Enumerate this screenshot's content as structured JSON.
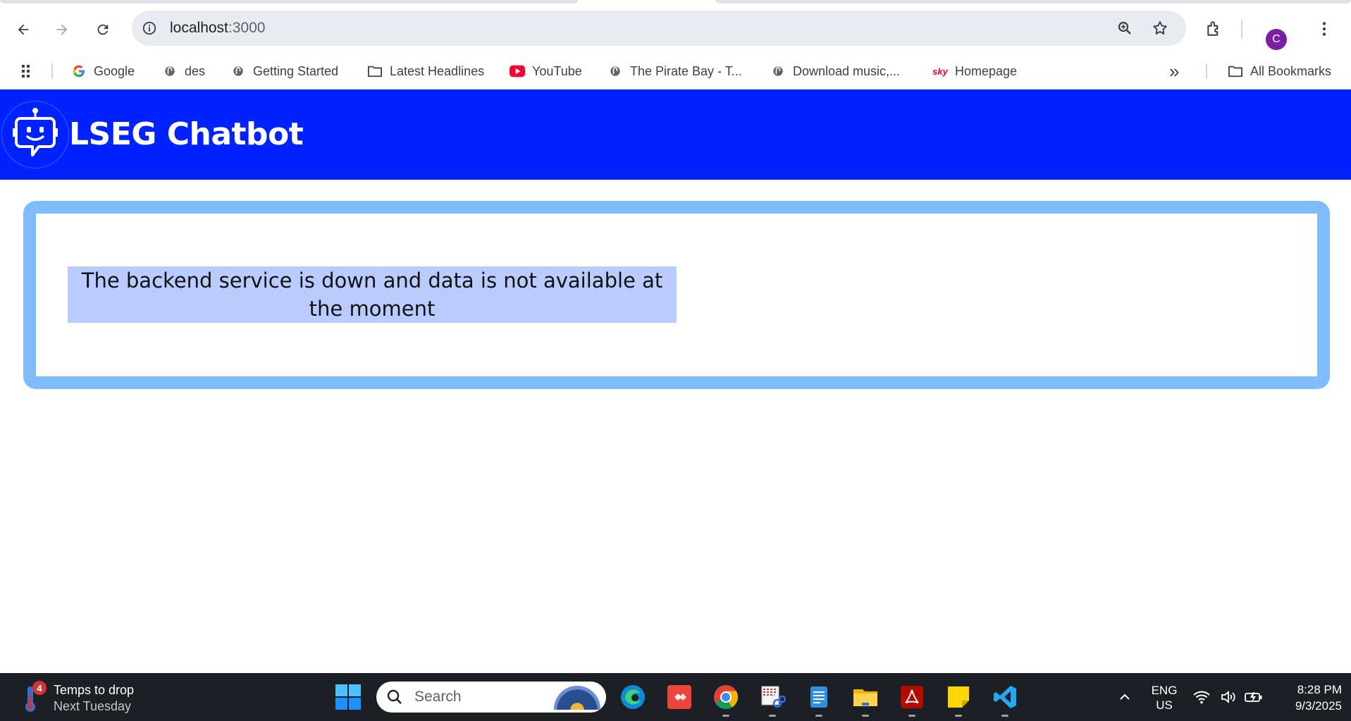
{
  "browser": {
    "url_host": "localhost",
    "url_rest": ":3000",
    "profile_initial": "C",
    "bookmarks": [
      {
        "label": "Google",
        "icon": "google-icon"
      },
      {
        "label": "des",
        "icon": "site-icon"
      },
      {
        "label": "Getting Started",
        "icon": "site-icon"
      },
      {
        "label": "Latest Headlines",
        "icon": "folder-icon"
      },
      {
        "label": "YouTube",
        "icon": "youtube-icon"
      },
      {
        "label": "The Pirate Bay - T...",
        "icon": "site-icon"
      },
      {
        "label": "Download music,...",
        "icon": "site-icon"
      },
      {
        "label": "Homepage",
        "icon": "sky-icon"
      }
    ],
    "more_bookmarks_glyph": "»",
    "all_bookmarks_label": "All Bookmarks",
    "sky_logo_text": "sky"
  },
  "app": {
    "title": "LSEG Chatbot",
    "message": "The backend service is down and data is not available at the moment",
    "colors": {
      "header": "#0022ff",
      "card_border": "#7fbcfd",
      "message_bg": "#b9ccfd"
    }
  },
  "taskbar": {
    "weather_title": "Temps to drop",
    "weather_subtitle": "Next Tuesday",
    "weather_badge": "4",
    "search_placeholder": "Search",
    "lang_line1": "ENG",
    "lang_line2": "US",
    "time": "8:28 PM",
    "date": "9/3/2025"
  }
}
